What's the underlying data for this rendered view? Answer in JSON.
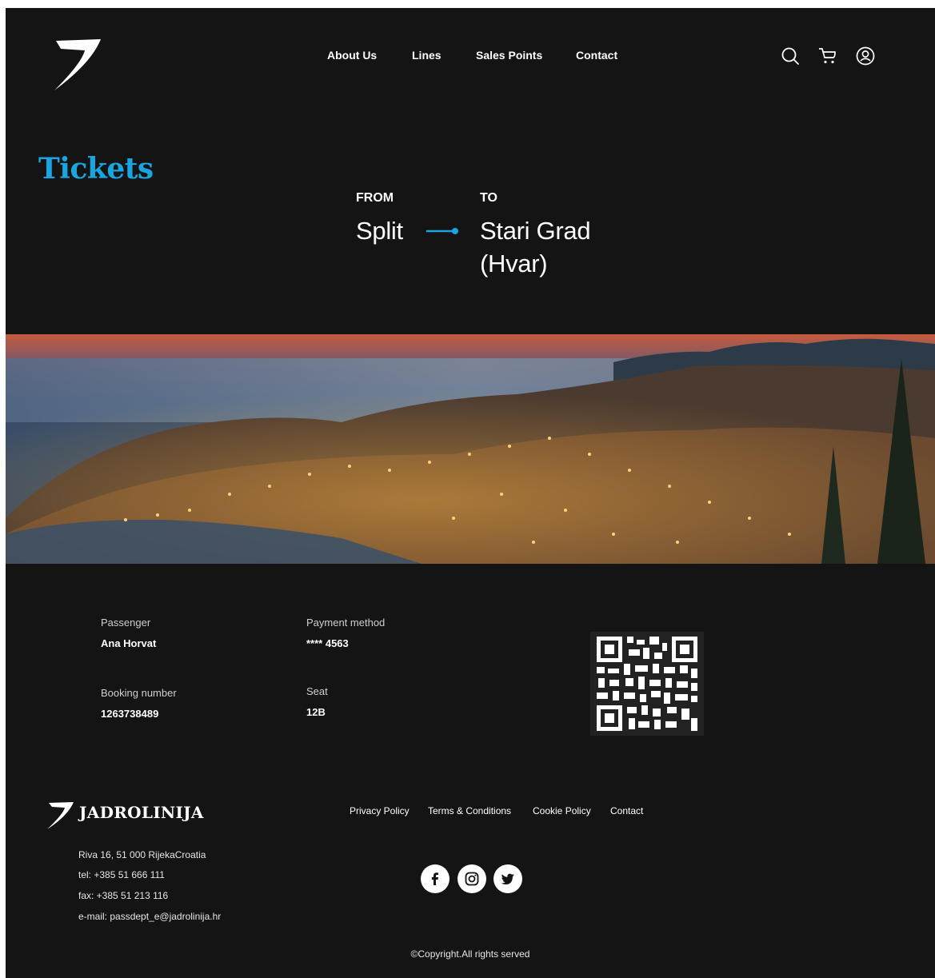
{
  "header": {
    "logo_icon": "jadrolinija-wing-logo-icon",
    "nav": [
      "About Us",
      "Lines",
      "Sales Points",
      "Contact"
    ],
    "icons": [
      "search-icon",
      "cart-icon",
      "user-account-icon"
    ]
  },
  "page": {
    "title": "Tickets"
  },
  "route": {
    "from_label": "FROM",
    "from_city": "Split",
    "to_label": "TO",
    "to_city_line1": "Stari Grad",
    "to_city_line2": "(Hvar)",
    "arrow_icon": "route-arrow-icon"
  },
  "hero_image": "dubrovnik-coastline-night-photo",
  "ticket": {
    "passenger_label": "Passenger",
    "passenger_value": "Ana Horvat",
    "payment_label": "Payment method",
    "payment_value": "**** 4563",
    "booking_label": "Booking number",
    "booking_value": "1263738489",
    "seat_label": "Seat",
    "seat_value": "12B",
    "qr_icon": "ticket-qr-code"
  },
  "footer": {
    "brand": "JADROLINIJA",
    "address": "Riva 16, 51 000 RijekaCroatia",
    "tel": "tel: +385 51 666 111",
    "fax": "fax: +385 51 213 116",
    "email": "e-mail: passdept_e@jadrolinija.hr",
    "links": [
      "Privacy Policy",
      "Terms & Conditions",
      "Cookie Policy",
      "Contact"
    ],
    "social": [
      "facebook-icon",
      "instagram-icon",
      "twitter-icon"
    ],
    "copyright": "©Copyright.All rights served"
  },
  "colors": {
    "background": "#141414",
    "accent": "#1aa5e0",
    "text": "#ffffff"
  }
}
